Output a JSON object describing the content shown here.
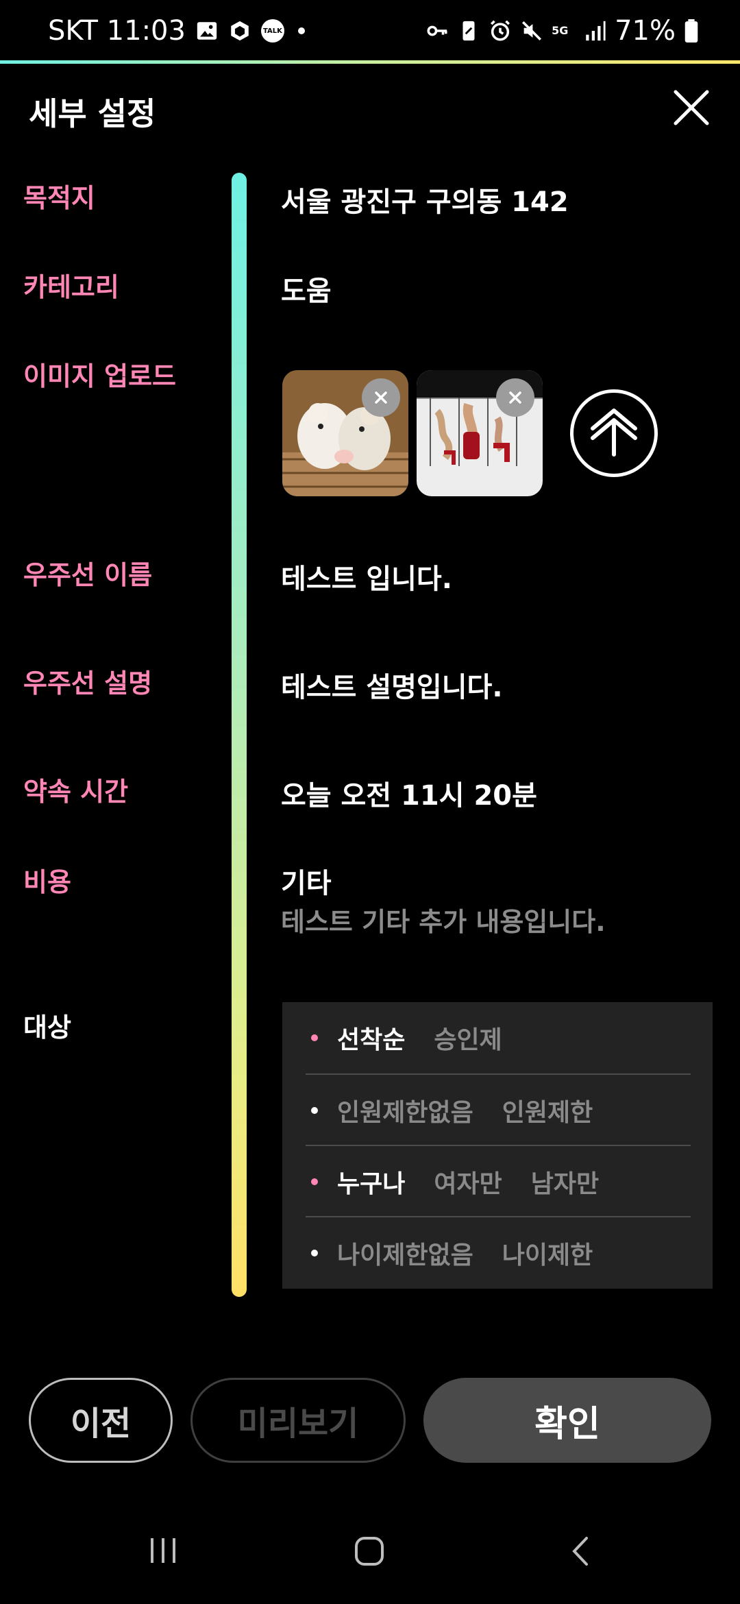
{
  "status_bar": {
    "carrier_time": "SKT 11:03",
    "battery": "71%",
    "network": "5G",
    "talk_badge": "TALK",
    "left_icons": [
      "gallery-icon",
      "box-icon",
      "kakaotalk-icon",
      "dot-icon"
    ],
    "right_icons": [
      "key-icon",
      "nfc-icon",
      "alarm-icon",
      "mute-icon",
      "5g-icon",
      "signal-icon",
      "battery-icon"
    ]
  },
  "header": {
    "title": "세부 설정"
  },
  "fields": {
    "destination": {
      "label": "목적지",
      "value": "서울 광진구 구의동 142"
    },
    "category": {
      "label": "카테고리",
      "value": "도움"
    },
    "image_upload": {
      "label": "이미지 업로드"
    },
    "ship_name": {
      "label": "우주선 이름",
      "value": "테스트 입니다."
    },
    "ship_desc": {
      "label": "우주선 설명",
      "value": "테스트 설명입니다."
    },
    "appointment": {
      "label": "약속 시간",
      "value": "오늘 오전 11시 20분"
    },
    "cost": {
      "label": "비용",
      "value": "기타",
      "detail": "테스트 기타 추가 내용입니다."
    },
    "target": {
      "label": "대상"
    }
  },
  "target_options": [
    {
      "options": [
        {
          "text": "선착순",
          "selected": true
        },
        {
          "text": "승인제",
          "selected": false
        }
      ],
      "active": true
    },
    {
      "options": [
        {
          "text": "인원제한없음",
          "selected": false
        },
        {
          "text": "인원제한",
          "selected": false
        }
      ],
      "active": false
    },
    {
      "options": [
        {
          "text": "누구나",
          "selected": true
        },
        {
          "text": "여자만",
          "selected": false
        },
        {
          "text": "남자만",
          "selected": false
        }
      ],
      "active": true
    },
    {
      "options": [
        {
          "text": "나이제한없음",
          "selected": false
        },
        {
          "text": "나이제한",
          "selected": false
        }
      ],
      "active": false
    }
  ],
  "buttons": {
    "prev": "이전",
    "preview": "미리보기",
    "confirm": "확인"
  },
  "colors": {
    "label_pink": "#ff86b5",
    "gradient_top": "#6ff0e3",
    "gradient_bottom": "#ffe066",
    "panel_bg": "#232323"
  }
}
